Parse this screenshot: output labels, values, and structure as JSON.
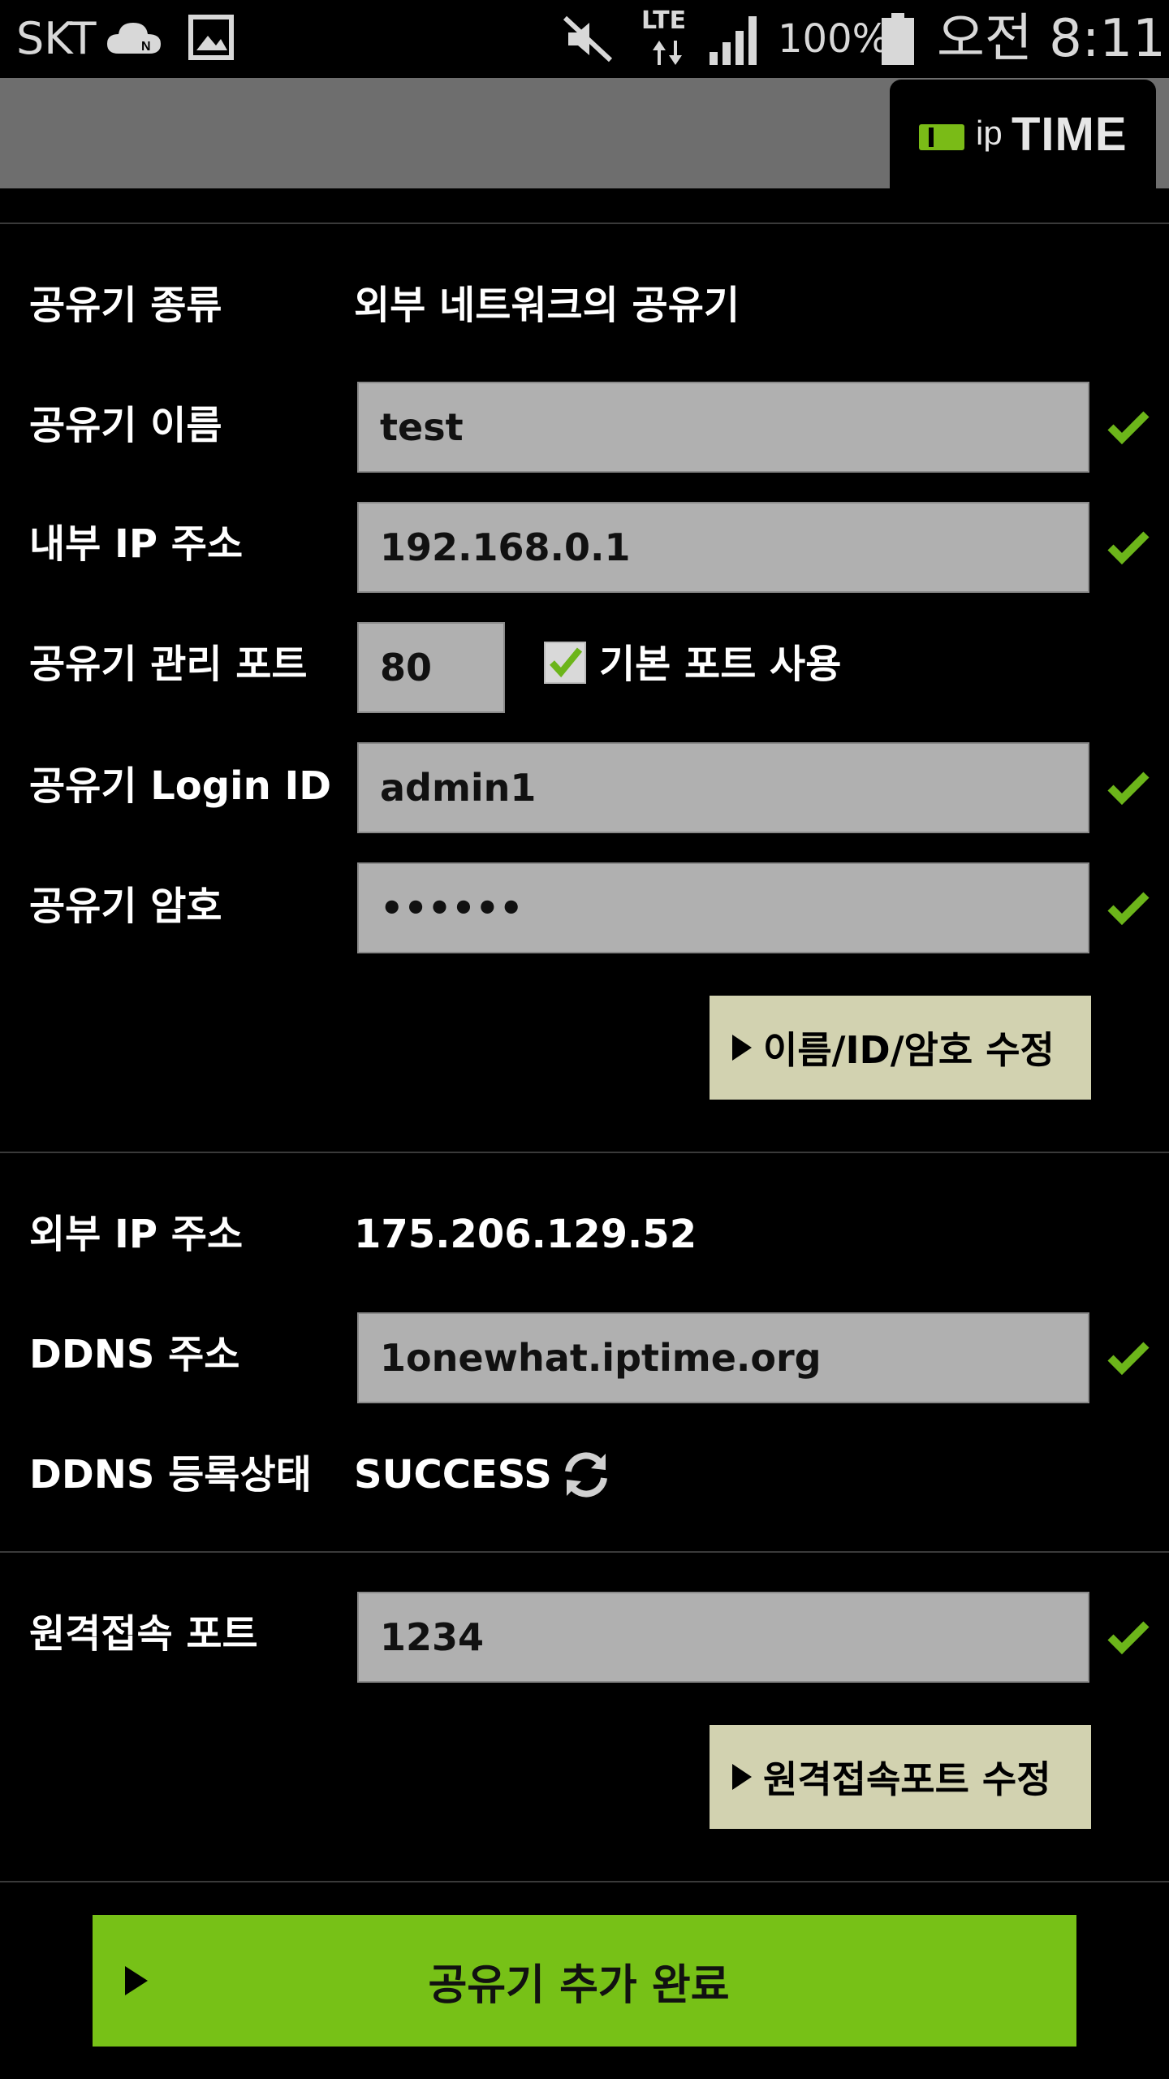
{
  "status_bar": {
    "carrier": "SKT",
    "network": "LTE",
    "battery": "100%",
    "time": "오전 8:11"
  },
  "header": {
    "logo_ip": "ip",
    "logo_time": "TIME"
  },
  "form": {
    "router_type_label": "공유기 종류",
    "router_type_value": "외부 네트워크의 공유기",
    "router_name_label": "공유기 이름",
    "router_name_value": "test",
    "internal_ip_label": "내부 IP 주소",
    "internal_ip_value": "192.168.0.1",
    "admin_port_label": "공유기 관리 포트",
    "admin_port_value": "80",
    "default_port_label": "기본 포트 사용",
    "login_id_label": "공유기 Login ID",
    "login_id_value": "admin1",
    "password_label": "공유기 암호",
    "password_value": "••••••",
    "edit_button_label": "이름/ID/암호 수정"
  },
  "external": {
    "external_ip_label": "외부 IP 주소",
    "external_ip_value": "175.206.129.52",
    "ddns_label": "DDNS 주소",
    "ddns_value": "1onewhat.iptime.org",
    "ddns_status_label": "DDNS 등록상태",
    "ddns_status_value": "SUCCESS"
  },
  "remote": {
    "remote_port_label": "원격접속 포트",
    "remote_port_value": "1234",
    "edit_button_label": "원격접속포트 수정"
  },
  "complete_button_label": "공유기 추가 완료",
  "colors": {
    "accent_green": "#77c117",
    "check_green": "#6cb51a",
    "button_beige": "#d2d2b0",
    "field_gray": "#b0b0b0"
  }
}
